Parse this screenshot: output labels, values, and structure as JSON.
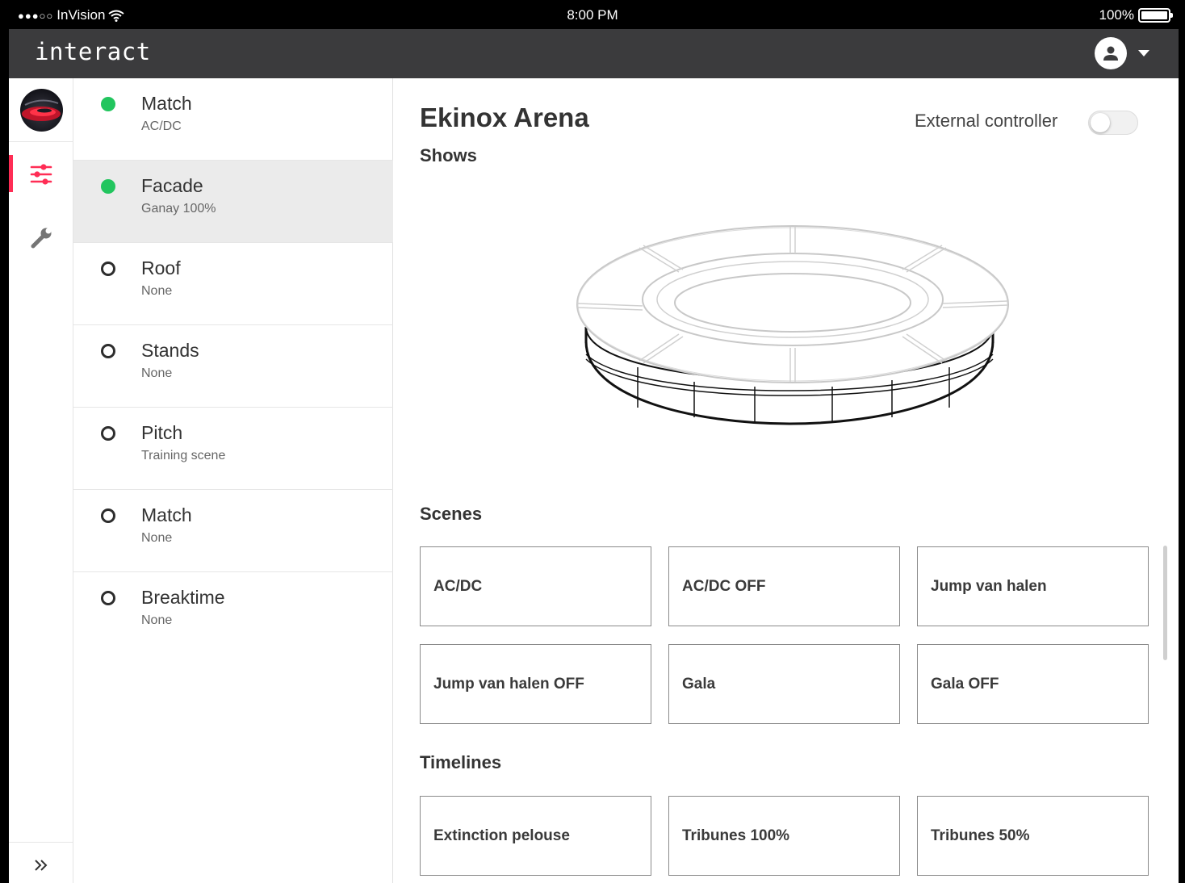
{
  "status_bar": {
    "carrier": "InVision",
    "time": "8:00 PM",
    "battery": "100%"
  },
  "app": {
    "logo": "interact"
  },
  "rail": {
    "items": [
      {
        "icon": "sliders-icon",
        "active": true
      },
      {
        "icon": "wrench-icon",
        "active": false
      }
    ],
    "expand_icon": "double-chevron-right-icon"
  },
  "zones": [
    {
      "name": "Match",
      "status": "AC/DC",
      "active": true
    },
    {
      "name": "Facade",
      "status": "Ganay 100%",
      "active": true,
      "selected": true
    },
    {
      "name": "Roof",
      "status": "None",
      "active": false
    },
    {
      "name": "Stands",
      "status": "None",
      "active": false
    },
    {
      "name": "Pitch",
      "status": "Training scene",
      "active": false
    },
    {
      "name": "Match",
      "status": "None",
      "active": false
    },
    {
      "name": "Breaktime",
      "status": "None",
      "active": false
    }
  ],
  "main": {
    "venue_title": "Ekinox Arena",
    "external_controller_label": "External controller",
    "external_controller_on": false,
    "shows_title": "Shows",
    "scenes_title": "Scenes",
    "timelines_title": "Timelines",
    "scenes": [
      "AC/DC",
      "AC/DC OFF",
      "Jump van halen",
      "Jump van halen OFF",
      "Gala",
      "Gala OFF"
    ],
    "timelines": [
      "Extinction pelouse",
      "Tribunes 100%",
      "Tribunes 50%"
    ]
  },
  "colors": {
    "accent": "#ff2d55",
    "active_dot": "#22c55e",
    "topbar": "#3b3b3d"
  }
}
